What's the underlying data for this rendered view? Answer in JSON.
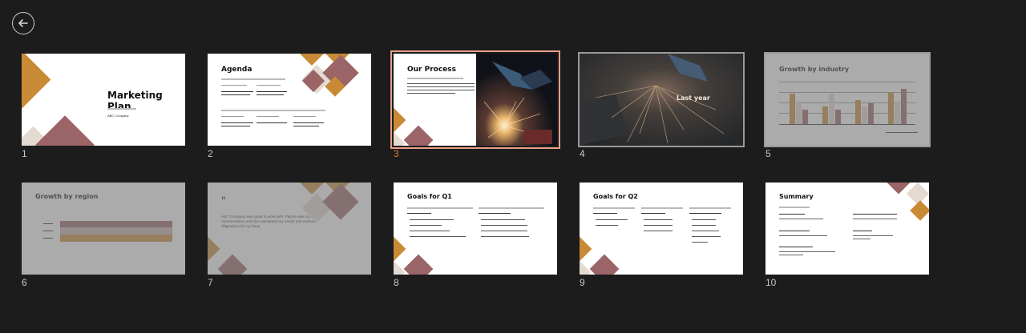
{
  "nav": {
    "back_label": "back"
  },
  "slides": [
    {
      "num": "1",
      "title": "Marketing Plan",
      "subtitle": "ABC Company"
    },
    {
      "num": "2",
      "title": "Agenda"
    },
    {
      "num": "3",
      "title": "Our Process"
    },
    {
      "num": "4",
      "title": "Last year"
    },
    {
      "num": "5",
      "title": "Growth by industry"
    },
    {
      "num": "6",
      "title": "Growth by region"
    },
    {
      "num": "7",
      "quote": "ABC Company was great to work with. Patrice was my representative and she anticipated my needs and worked diligently to fix my issue."
    },
    {
      "num": "8",
      "title": "Goals for Q1"
    },
    {
      "num": "9",
      "title": "Goals for Q2"
    },
    {
      "num": "10",
      "title": "Summary"
    }
  ],
  "colors": {
    "gold": "#c98a35",
    "mauve": "#9b6466",
    "beige": "#e4dad2",
    "selected_outline": "#e8a08a",
    "active_number": "#e07b3c"
  }
}
